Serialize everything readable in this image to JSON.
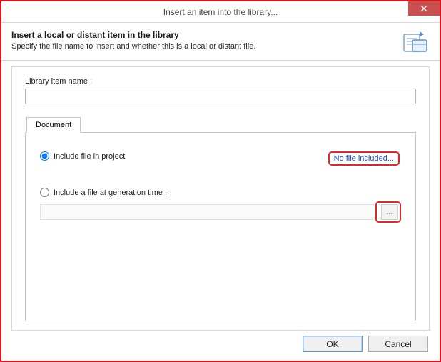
{
  "window": {
    "title": "Insert an item into the library..."
  },
  "header": {
    "title": "Insert a local or distant item in the library",
    "subtitle": "Specify the file name to insert and whether this is a local or distant file."
  },
  "form": {
    "library_item_label": "Library item name :",
    "library_item_value": ""
  },
  "tabs": {
    "document": "Document"
  },
  "options": {
    "include_in_project_label": "Include file in project",
    "no_file_link": "No file included...",
    "include_at_gen_label": "Include a file at generation time :",
    "gen_path_value": "",
    "browse_label": "..."
  },
  "buttons": {
    "ok": "OK",
    "cancel": "Cancel"
  }
}
